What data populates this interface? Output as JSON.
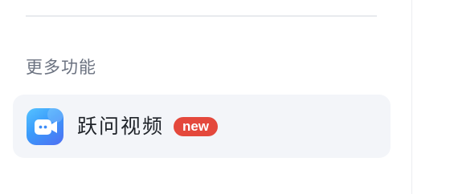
{
  "section": {
    "title": "更多功能"
  },
  "features": [
    {
      "label": "跃问视频",
      "icon": "video-camera-app-icon",
      "badge": "new"
    }
  ],
  "colors": {
    "item_background": "#f3f5f9",
    "badge_background": "#e4483c",
    "icon_gradient_start": "#56c3ff",
    "icon_gradient_end": "#4f6ef2",
    "section_title": "#6b7280",
    "label_text": "#1f2329"
  }
}
